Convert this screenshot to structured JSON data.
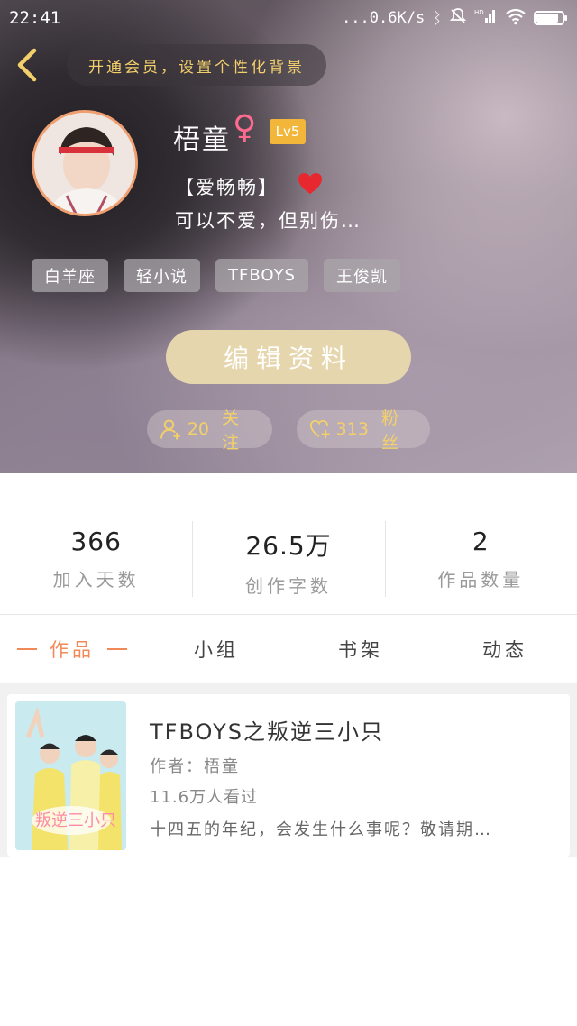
{
  "status_bar": {
    "time": "22:41",
    "network_speed": "...0.6K/s",
    "battery_level": 0.85
  },
  "header": {
    "vip_banner": "开通会员，设置个性化背景"
  },
  "profile": {
    "nickname": "梧童",
    "gender_symbol": "♀",
    "level": "Lv5",
    "signature_title": "【爱畅畅】",
    "signature": "可以不爱，但别伤…",
    "tags": [
      "白羊座",
      "轻小说",
      "TFBOYS",
      "王俊凯"
    ],
    "edit_button": "编辑资料",
    "following_count": "20",
    "following_label": "关注",
    "fans_count": "313",
    "fans_label": "粉丝"
  },
  "stats": [
    {
      "value": "366",
      "label": "加入天数"
    },
    {
      "value": "26.5万",
      "label": "创作字数"
    },
    {
      "value": "2",
      "label": "作品数量"
    }
  ],
  "tabs": [
    {
      "label": "作品",
      "active": true
    },
    {
      "label": "小组",
      "active": false
    },
    {
      "label": "书架",
      "active": false
    },
    {
      "label": "动态",
      "active": false
    }
  ],
  "works": [
    {
      "title": "TFBOYS之叛逆三小只",
      "author": "作者：梧童",
      "views": "11.6万人看过",
      "description": "十四五的年纪，会发生什么事呢？敬请期…"
    }
  ],
  "colors": {
    "accent": "#f28a57",
    "gold": "#f3d06a",
    "level_badge": "#f2b63a",
    "edit_button": "#e6d6ad"
  },
  "icons": [
    "back-arrow-icon",
    "bluetooth-icon",
    "mute-icon",
    "hd-icon",
    "signal-icon",
    "wifi-icon",
    "battery-icon",
    "heart-icon",
    "user-plus-icon",
    "heart-plus-icon"
  ]
}
